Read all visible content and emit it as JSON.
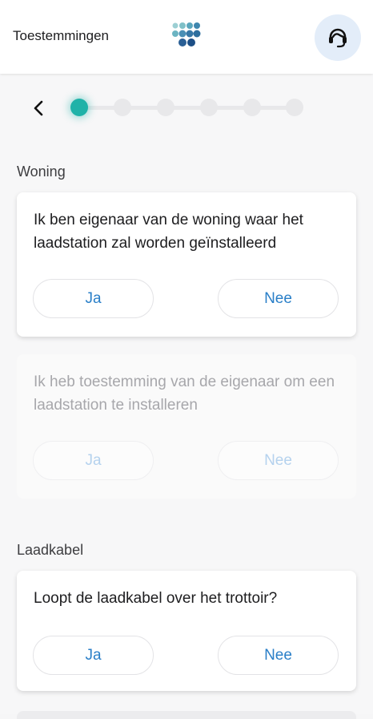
{
  "header": {
    "title": "Toestemmingen",
    "logo_icon": "dot-grid-logo",
    "support_icon": "headset-icon",
    "logo_colors": [
      "#7fc0c8",
      "#4a8fb5",
      "#2f6f9e",
      "#1d4f86"
    ]
  },
  "stepper": {
    "back_icon": "chevron-left-icon",
    "total_steps": 6,
    "current_step": 1,
    "accent_color": "#1fb2a8"
  },
  "sections": [
    {
      "title": "Woning",
      "questions": [
        {
          "text": "Ik ben eigenaar van de woning waar het laadstation zal worden geïnstalleerd",
          "yes_label": "Ja",
          "no_label": "Nee",
          "enabled": true
        },
        {
          "text": "Ik heb toestemming van de eigenaar om een laadstation te installeren",
          "yes_label": "Ja",
          "no_label": "Nee",
          "enabled": false
        }
      ]
    },
    {
      "title": "Laadkabel",
      "questions": [
        {
          "text": "Loopt de laadkabel over het trottoir?",
          "yes_label": "Ja",
          "no_label": "Nee",
          "enabled": true
        }
      ]
    }
  ],
  "colors": {
    "button_text": "#2a7fc8",
    "support_bg": "#e3edf9"
  }
}
